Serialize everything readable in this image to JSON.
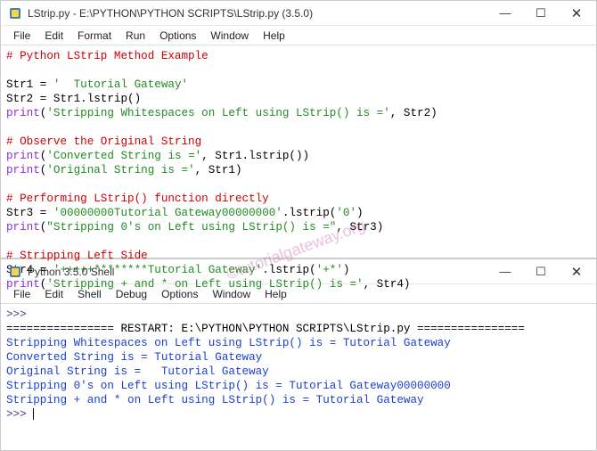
{
  "window1": {
    "title": "LStrip.py - E:\\PYTHON\\PYTHON SCRIPTS\\LStrip.py (3.5.0)",
    "menu": [
      "File",
      "Edit",
      "Format",
      "Run",
      "Options",
      "Window",
      "Help"
    ],
    "code": {
      "c1": "# Python LStrip Method Example",
      "l2a": "Str1 = ",
      "l2b": "'  Tutorial Gateway'",
      "l3": "Str2 = Str1.lstrip()",
      "l4a": "print",
      "l4b": "(",
      "l4c": "'Stripping Whitespaces on Left using LStrip() is ='",
      "l4d": ", Str2)",
      "c2": "# Observe the Original String",
      "l6a": "print",
      "l6b": "(",
      "l6c": "'Converted String is ='",
      "l6d": ", Str1.lstrip())",
      "l7a": "print",
      "l7b": "(",
      "l7c": "'Original String is ='",
      "l7d": ", Str1)",
      "c3": "# Performing LStrip() function directly",
      "l9a": "Str3 = ",
      "l9b": "'00000000Tutorial Gateway00000000'",
      "l9c": ".lstrip(",
      "l9d": "'0'",
      "l9e": ")",
      "l10a": "print",
      "l10b": "(",
      "l10c": "\"Stripping 0's on Left using LStrip() is =\"",
      "l10d": ", Str3)",
      "c4": "# Stripping Left Side",
      "l12a": "Str4 = ",
      "l12b": "'+++++********Tutorial Gateway'",
      "l12c": ".lstrip(",
      "l12d": "'+*'",
      "l12e": ")",
      "l13a": "print",
      "l13b": "(",
      "l13c": "'Stripping + and * on Left using LStrip() is ='",
      "l13d": ", Str4)"
    }
  },
  "window2": {
    "title": "Python 3.5.0 Shell",
    "menu": [
      "File",
      "Edit",
      "Shell",
      "Debug",
      "Options",
      "Window",
      "Help"
    ],
    "shell": {
      "prompt": ">>>",
      "restart": "================ RESTART: E:\\PYTHON\\PYTHON SCRIPTS\\LStrip.py ================",
      "o1": "Stripping Whitespaces on Left using LStrip() is = Tutorial Gateway",
      "o2": "Converted String is = Tutorial Gateway",
      "o3": "Original String is =   Tutorial Gateway",
      "o4": "Stripping 0's on Left using LStrip() is = Tutorial Gateway00000000",
      "o5": "Stripping + and * on Left using LStrip() is = Tutorial Gateway"
    }
  },
  "watermark": "©tutorialgateway.org",
  "wincontrols": {
    "min": "—",
    "max": "☐",
    "close": "✕"
  }
}
